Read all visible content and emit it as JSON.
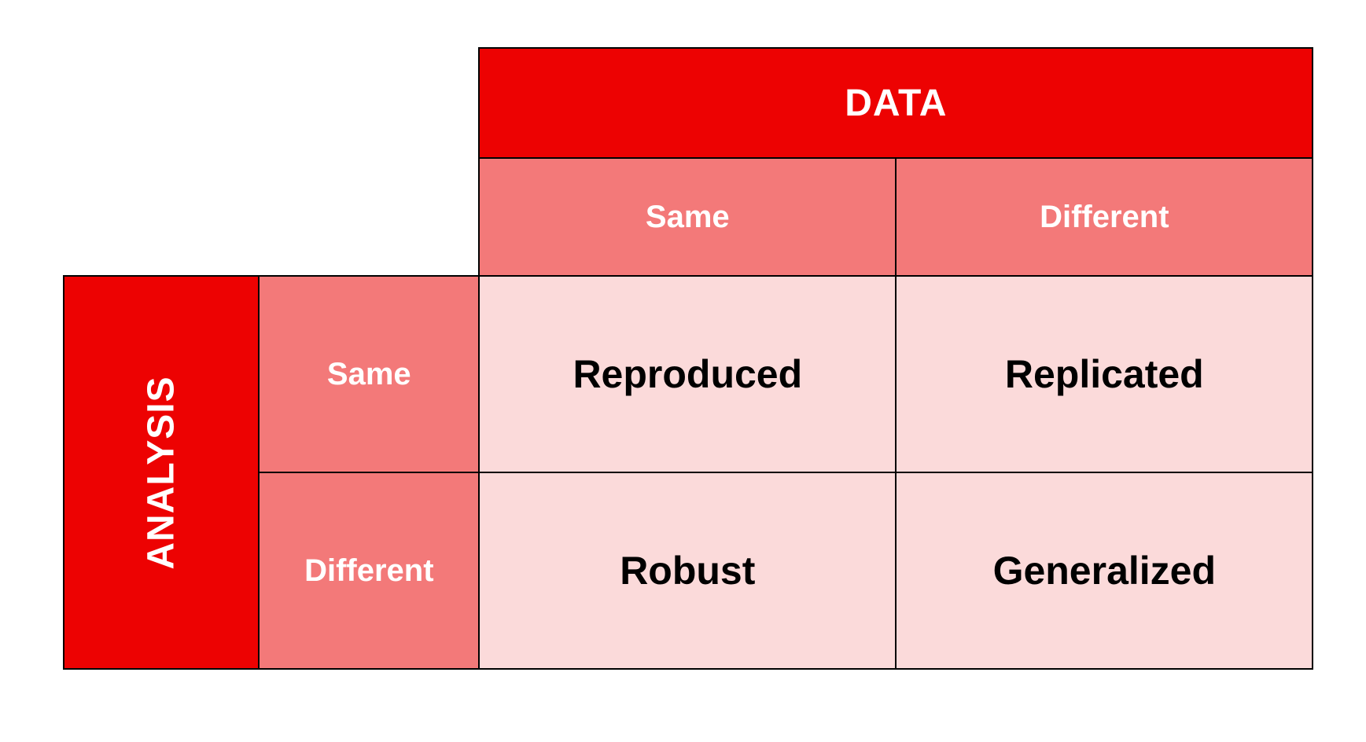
{
  "chart_data": {
    "type": "table",
    "title": "",
    "column_axis": "DATA",
    "row_axis": "ANALYSIS",
    "column_headers": [
      "Same",
      "Different"
    ],
    "row_headers": [
      "Same",
      "Different"
    ],
    "cells": [
      [
        "Reproduced",
        "Replicated"
      ],
      [
        "Robust",
        "Generalized"
      ]
    ]
  },
  "labels": {
    "data_header": "DATA",
    "analysis_header": "ANALYSIS",
    "col_same": "Same",
    "col_different": "Different",
    "row_same": "Same",
    "row_different": "Different",
    "cell_00": "Reproduced",
    "cell_01": "Replicated",
    "cell_10": "Robust",
    "cell_11": "Generalized"
  }
}
